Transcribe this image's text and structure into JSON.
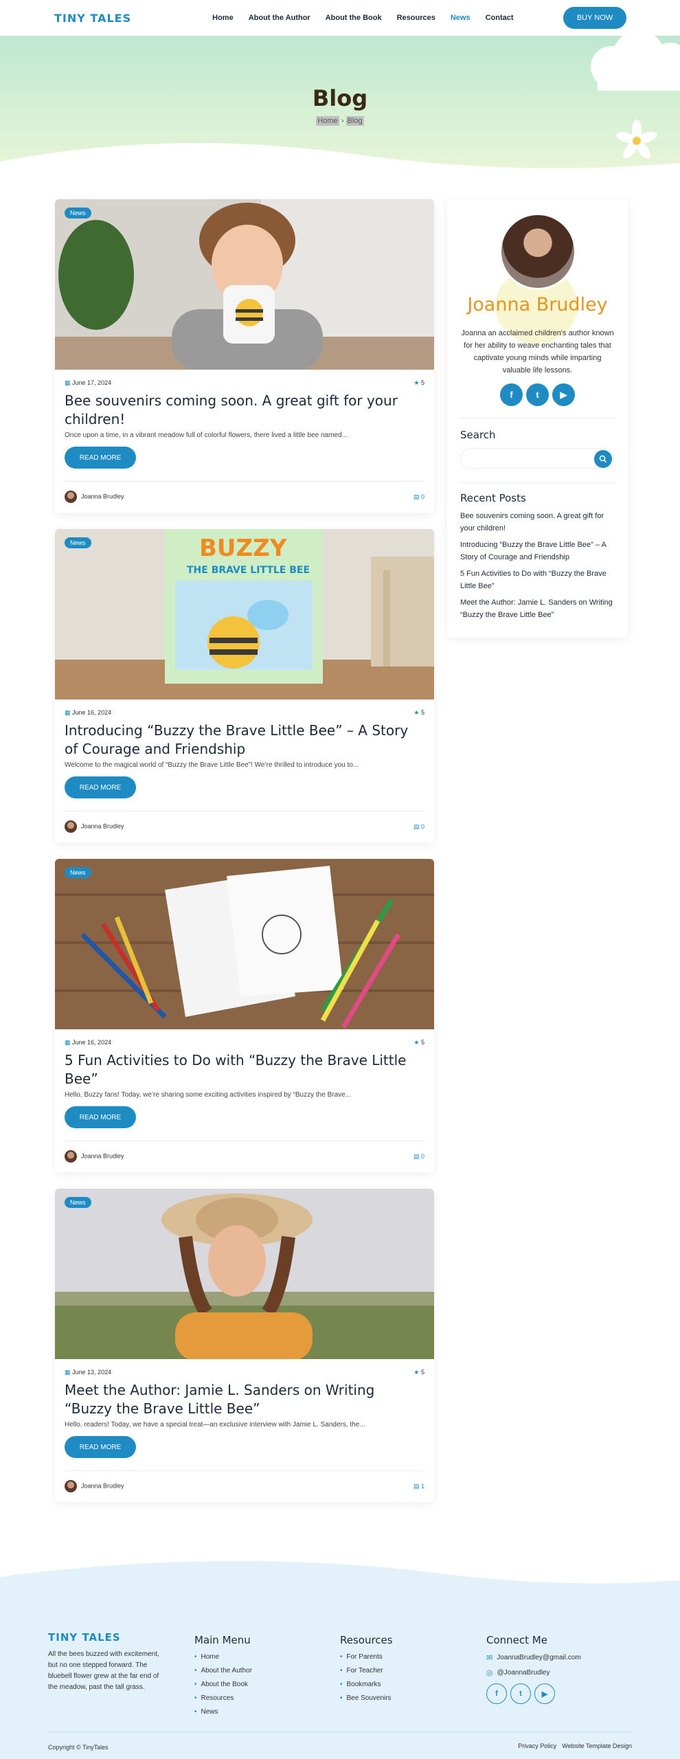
{
  "header": {
    "logo": "TINY TALES",
    "nav": [
      {
        "label": "Home"
      },
      {
        "label": "About the Author"
      },
      {
        "label": "About the Book"
      },
      {
        "label": "Resources"
      },
      {
        "label": "News"
      },
      {
        "label": "Contact"
      }
    ],
    "active_nav": "News",
    "buy_label": "BUY NOW"
  },
  "hero": {
    "title": "Blog",
    "breadcrumb": [
      "Home",
      "Blog"
    ]
  },
  "posts": [
    {
      "badge": "News",
      "date": "June 17, 2024",
      "rating": "5",
      "title": "Bee souvenirs coming soon. A great gift for your children!",
      "excerpt": "Once upon a time, in a vibrant meadow full of colorful flowers, there lived a little bee named...",
      "read_more": "READ MORE",
      "author": "Joanna Brudley",
      "comments": "0"
    },
    {
      "badge": "News",
      "date": "June 16, 2024",
      "rating": "5",
      "title": "Introducing “Buzzy the Brave Little Bee” – A Story of Courage and Friendship",
      "excerpt": "Welcome to the magical world of “Buzzy the Brave Little Bee”! We’re thrilled to introduce you to...",
      "read_more": "READ MORE",
      "author": "Joanna Brudley",
      "comments": "0",
      "book_title_1": "BUZZY",
      "book_title_2": "THE BRAVE LITTLE BEE"
    },
    {
      "badge": "News",
      "date": "June 16, 2024",
      "rating": "5",
      "title": "5 Fun Activities to Do with “Buzzy the Brave Little Bee”",
      "excerpt": "Hello, Buzzy fans! Today, we’re sharing some exciting activities inspired by “Buzzy the Brave...",
      "read_more": "READ MORE",
      "author": "Joanna Brudley",
      "comments": "0"
    },
    {
      "badge": "News",
      "date": "June 13, 2024",
      "rating": "5",
      "title": "Meet the Author: Jamie L. Sanders on Writing “Buzzy the Brave Little Bee”",
      "excerpt": "Hello, readers! Today, we have a special treat—an exclusive interview with Jamie L. Sanders, the...",
      "read_more": "READ MORE",
      "author": "Joanna Brudley",
      "comments": "1"
    }
  ],
  "sidebar": {
    "name": "Joanna Brudley",
    "bio": "Joanna an acclaimed children's author known for her ability to weave enchanting tales that captivate young minds while imparting valuable life lessons.",
    "social": [
      "f",
      "t",
      "▶"
    ],
    "search_heading": "Search",
    "search_placeholder": "",
    "recent_heading": "Recent Posts",
    "recent": [
      "Bee souvenirs coming soon. A great gift for your children!",
      "Introducing “Buzzy the Brave Little Bee” – A Story of Courage and Friendship",
      "5 Fun Activities to Do with “Buzzy the Brave Little Bee”",
      "Meet the Author: Jamie L. Sanders on Writing “Buzzy the Brave Little Bee”"
    ]
  },
  "footer": {
    "logo": "TINY TALES",
    "about": "All the bees buzzed with excitement, but no one stepped forward. The bluebell flower grew at the far end of the meadow, past the tall grass.",
    "main_menu": {
      "heading": "Main Menu",
      "items": [
        "Home",
        "About the Author",
        "About the Book",
        "Resources",
        "News"
      ]
    },
    "resources": {
      "heading": "Resources",
      "items": [
        "For Parents",
        "For Teacher",
        "Bookmarks",
        "Bee Souvenirs"
      ]
    },
    "connect": {
      "heading": "Connect Me",
      "email": "JoannaBrudley@gmail.com",
      "instagram": "@JoannaBrudley",
      "social": [
        "f",
        "t",
        "▶"
      ]
    },
    "copyright": "Copyright © TinyTales",
    "links": [
      "Privacy Policy",
      "Website Template Design"
    ]
  },
  "colors": {
    "accent": "#1e8bc3",
    "name_orange": "#e8931e"
  }
}
